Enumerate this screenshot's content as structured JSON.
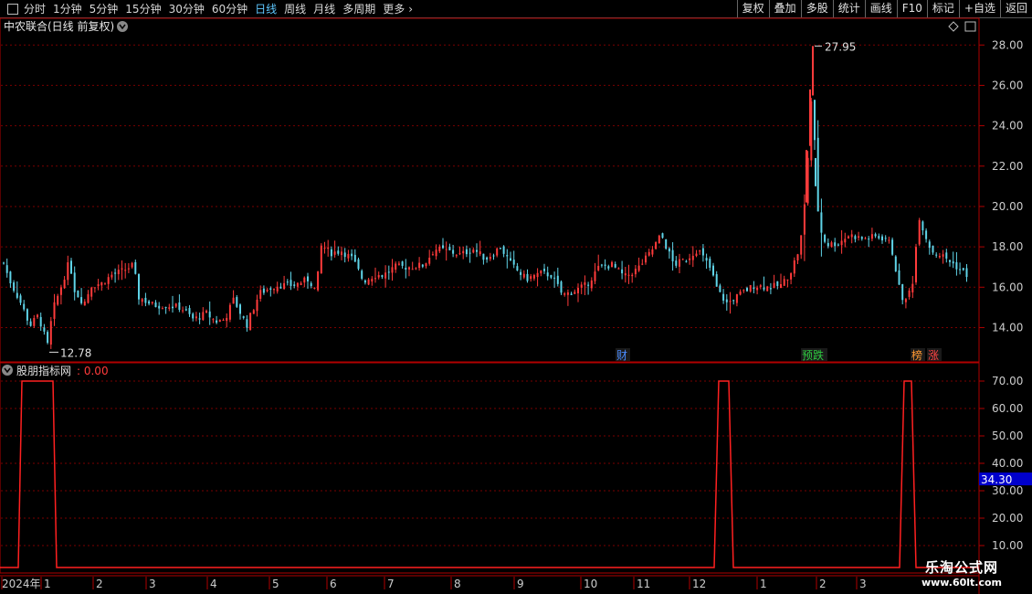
{
  "toolbar": {
    "periods": [
      "分时",
      "1分钟",
      "5分钟",
      "15分钟",
      "30分钟",
      "60分钟",
      "日线",
      "周线",
      "月线",
      "多周期",
      "更多"
    ],
    "active_period": "日线",
    "buttons": [
      "复权",
      "叠加",
      "多股",
      "统计",
      "画线",
      "F10",
      "标记",
      "+自选",
      "返回"
    ]
  },
  "main_panel": {
    "title": "中农联合(日线 前复权)",
    "high_label": "27.95",
    "low_label": "12.78",
    "events": [
      {
        "text": "财",
        "color": "#4a8cff"
      },
      {
        "text": "预跌",
        "color": "#2ecc40"
      },
      {
        "text": "榜",
        "color": "#ff9933"
      },
      {
        "text": "涨",
        "color": "#ff4444"
      }
    ],
    "colors": {
      "up": "#ff3b3b",
      "down": "#5fd4e8",
      "grid": "#7a0000",
      "frame": "#b00000",
      "axis_text": "#cccccc"
    }
  },
  "indicator_panel": {
    "name": "股朋指标网",
    "value": ": 0.00",
    "current_marker": "34.30",
    "line_color": "#ff2020"
  },
  "time_axis": {
    "labels": [
      "2024年",
      "1",
      "2",
      "3",
      "4",
      "5",
      "6",
      "7",
      "8",
      "9",
      "10",
      "11",
      "12",
      "1",
      "2",
      "3"
    ]
  },
  "watermark": {
    "line1": "乐淘公式网",
    "line2": "www.60lt.com"
  },
  "chart_data": [
    {
      "type": "candlestick",
      "title": "中农联合(日线 前复权)",
      "y_ticks": [
        14,
        16,
        18,
        20,
        22,
        24,
        26,
        28
      ],
      "ylim": [
        12.3,
        28.6
      ],
      "high": 27.95,
      "low": 12.78,
      "segments": [
        [
          0,
          17.8
        ],
        [
          6,
          16.9
        ],
        [
          12,
          16.2
        ],
        [
          22,
          15.3
        ],
        [
          33,
          14.1
        ],
        [
          42,
          14.6
        ],
        [
          52,
          13.1
        ],
        [
          58,
          14.9
        ],
        [
          66,
          15.9
        ],
        [
          76,
          17.3
        ],
        [
          82,
          15.8
        ],
        [
          92,
          15.2
        ],
        [
          100,
          16.1
        ],
        [
          112,
          16.2
        ],
        [
          122,
          16.6
        ],
        [
          134,
          16.8
        ],
        [
          146,
          17.1
        ],
        [
          152,
          15.5
        ],
        [
          168,
          15.1
        ],
        [
          182,
          15.1
        ],
        [
          198,
          15.0
        ],
        [
          212,
          14.4
        ],
        [
          226,
          14.7
        ],
        [
          236,
          14.3
        ],
        [
          246,
          14.4
        ],
        [
          256,
          15.4
        ],
        [
          270,
          14.1
        ],
        [
          284,
          15.7
        ],
        [
          302,
          16.1
        ],
        [
          322,
          16.1
        ],
        [
          338,
          16.4
        ],
        [
          346,
          15.8
        ],
        [
          352,
          18.1
        ],
        [
          362,
          17.7
        ],
        [
          374,
          17.8
        ],
        [
          386,
          17.4
        ],
        [
          398,
          16.3
        ],
        [
          410,
          16.6
        ],
        [
          420,
          16.6
        ],
        [
          432,
          17.0
        ],
        [
          448,
          17.0
        ],
        [
          464,
          17.1
        ],
        [
          476,
          17.9
        ],
        [
          490,
          17.8
        ],
        [
          504,
          17.6
        ],
        [
          518,
          17.9
        ],
        [
          532,
          17.4
        ],
        [
          548,
          18.0
        ],
        [
          560,
          17.1
        ],
        [
          576,
          16.4
        ],
        [
          592,
          16.7
        ],
        [
          604,
          16.6
        ],
        [
          616,
          15.6
        ],
        [
          628,
          15.8
        ],
        [
          642,
          16.1
        ],
        [
          656,
          17.0
        ],
        [
          670,
          17.1
        ],
        [
          684,
          16.5
        ],
        [
          698,
          16.9
        ],
        [
          712,
          17.7
        ],
        [
          724,
          18.6
        ],
        [
          738,
          17.1
        ],
        [
          752,
          17.4
        ],
        [
          764,
          17.9
        ],
        [
          778,
          16.9
        ],
        [
          786,
          15.8
        ],
        [
          796,
          15.2
        ],
        [
          812,
          15.7
        ],
        [
          826,
          16.1
        ],
        [
          842,
          16.0
        ],
        [
          856,
          16.1
        ],
        [
          866,
          16.8
        ],
        [
          876,
          18.0
        ],
        [
          882,
          20.5
        ],
        [
          886,
          23.5
        ],
        [
          890,
          26.5
        ],
        [
          893,
          21.5
        ],
        [
          897,
          19.0
        ],
        [
          905,
          18.1
        ],
        [
          918,
          18.2
        ],
        [
          930,
          18.6
        ],
        [
          944,
          18.4
        ],
        [
          958,
          18.5
        ],
        [
          972,
          18.4
        ],
        [
          978,
          17.6
        ],
        [
          986,
          15.6
        ],
        [
          992,
          15.3
        ],
        [
          1000,
          16.4
        ],
        [
          1006,
          19.6
        ],
        [
          1012,
          18.7
        ],
        [
          1020,
          17.8
        ],
        [
          1034,
          17.5
        ],
        [
          1048,
          17.0
        ],
        [
          1062,
          16.5
        ]
      ]
    },
    {
      "type": "line",
      "name": "股朋指标网",
      "y_ticks": [
        10,
        20,
        30,
        40,
        50,
        60,
        70
      ],
      "ylim": [
        0,
        75
      ],
      "current": 0.0,
      "marker": 34.3,
      "points": [
        [
          0,
          2
        ],
        [
          20,
          2
        ],
        [
          24,
          70
        ],
        [
          58,
          70
        ],
        [
          62,
          2
        ],
        [
          782,
          2
        ],
        [
          787,
          70
        ],
        [
          798,
          70
        ],
        [
          803,
          2
        ],
        [
          985,
          2
        ],
        [
          990,
          70
        ],
        [
          998,
          70
        ],
        [
          1003,
          2
        ],
        [
          1072,
          2
        ]
      ]
    }
  ]
}
